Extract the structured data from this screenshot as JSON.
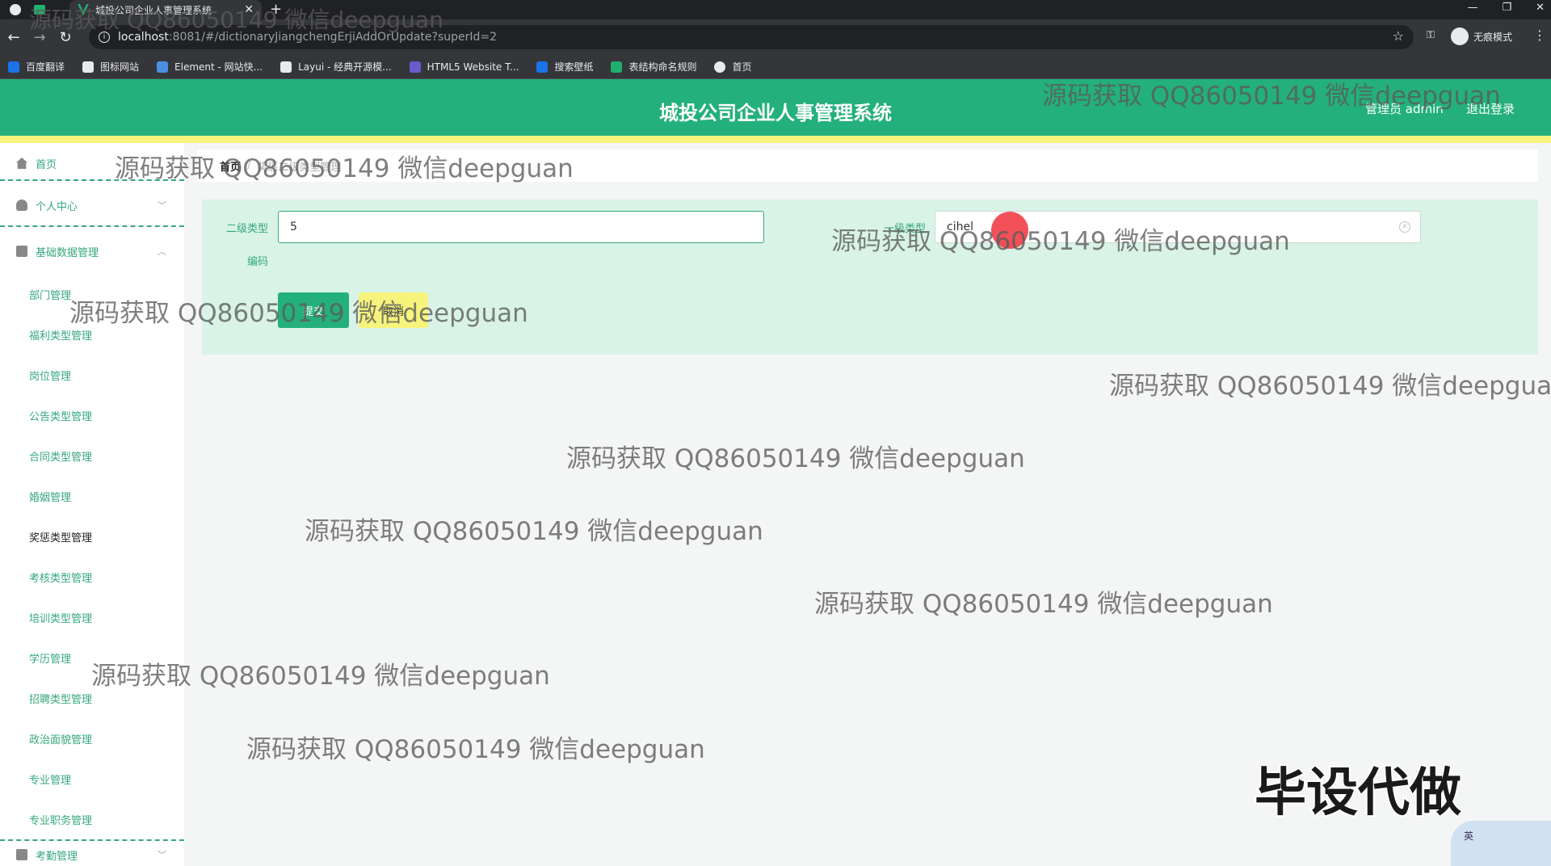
{
  "browser": {
    "tab_title": "城投公司企业人事管理系统",
    "url_host": "localhost",
    "url_path": ":8081/#/dictionaryJiangchengErjiAddOrUpdate?superId=2",
    "incognito_label": "无痕模式",
    "bookmarks": [
      "百度翻译",
      "图标网站",
      "Element - 网站快...",
      "Layui - 经典开源模...",
      "HTML5 Website T...",
      "搜索壁纸",
      "表结构命名规则",
      "首页"
    ],
    "bookmark_colors": [
      "#1a73e8",
      "#e8eaed",
      "#4a90e2",
      "#e8eaed",
      "#6a5acd",
      "#1a73e8",
      "#1fb06f",
      "#e8eaed"
    ]
  },
  "header": {
    "title": "城投公司企业人事管理系统",
    "admin": "管理员 admin",
    "logout": "退出登录"
  },
  "sidebar": {
    "home": "首页",
    "personal": "个人中心",
    "basic_data": "基础数据管理",
    "sub_items": [
      "部门管理",
      "福利类型管理",
      "岗位管理",
      "公告类型管理",
      "合同类型管理",
      "婚姻管理",
      "奖惩类型管理",
      "考核类型管理",
      "培训类型管理",
      "学历管理",
      "招聘类型管理",
      "政治面貌管理",
      "专业管理",
      "专业职务管理"
    ],
    "attendance": "考勤管理"
  },
  "breadcrumb": {
    "home": "首页",
    "current": "奖惩二级类型管理"
  },
  "form": {
    "secondary_type_label": "二级类型",
    "code_label": "编码",
    "secondary_type_value": "5",
    "primary_type_label": "一级类型",
    "primary_type_value": "cihel",
    "submit": "提交",
    "cancel": "取消"
  },
  "watermark": "源码获取 QQ86050149 微信deepguan",
  "big_watermark": "毕设代做",
  "ime_label": "英"
}
